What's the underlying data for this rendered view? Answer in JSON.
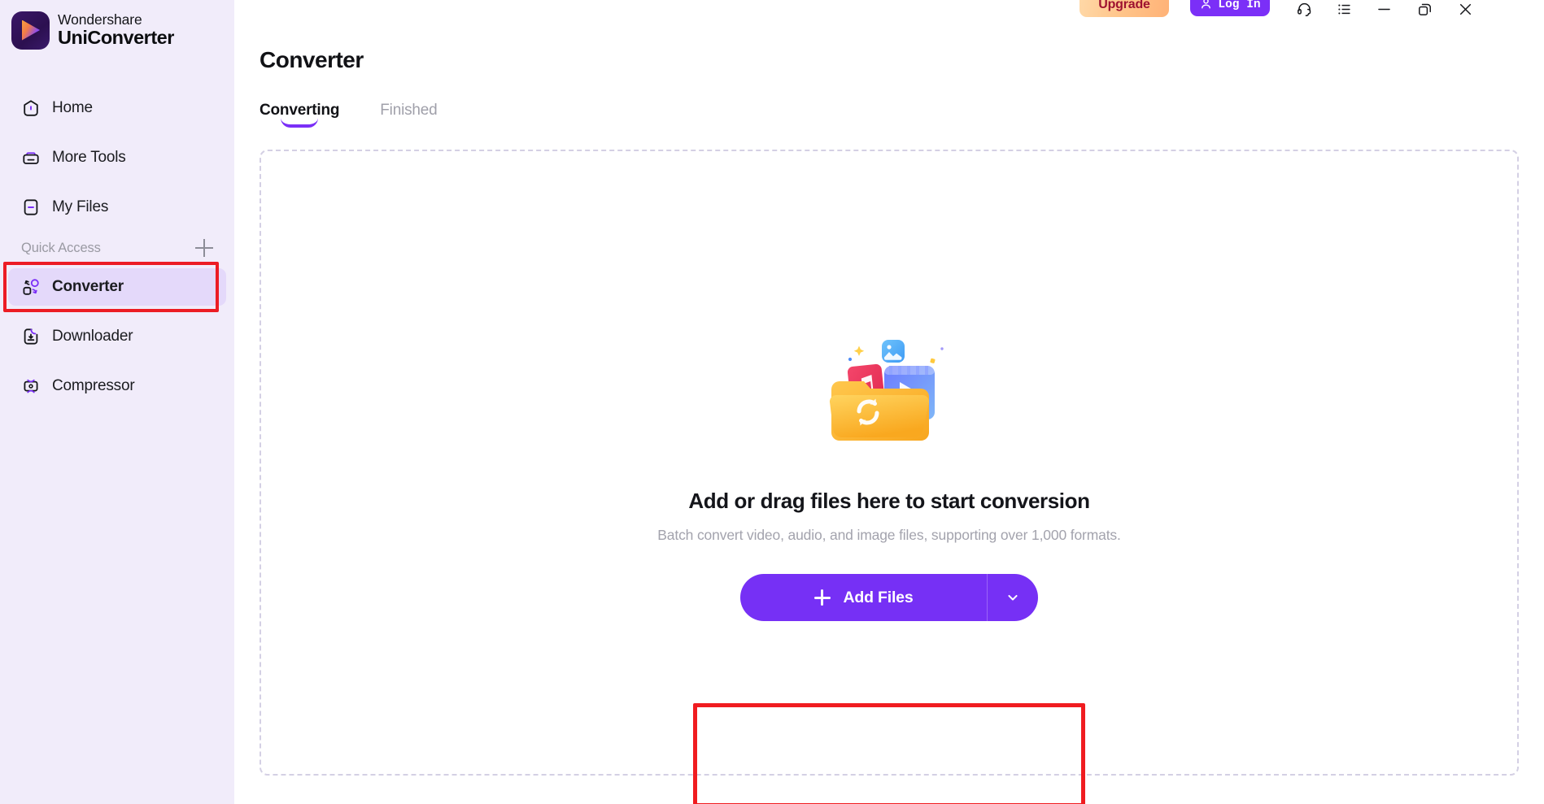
{
  "brand": {
    "line1": "Wondershare",
    "line2": "UniConverter",
    "logo_icon": "play-logo-icon",
    "logo_colors": {
      "bg": "#2c1050",
      "accent_start": "#f9a03c",
      "accent_end": "#b06cf7"
    }
  },
  "sidebar": {
    "background": "#f1ecfa",
    "active_background": "#e4d9fa",
    "items": [
      {
        "id": "home",
        "label": "Home",
        "icon": "home-icon",
        "active": false
      },
      {
        "id": "more-tools",
        "label": "More Tools",
        "icon": "toolbox-icon",
        "active": false
      },
      {
        "id": "my-files",
        "label": "My Files",
        "icon": "file-icon",
        "active": false
      },
      {
        "id": "converter",
        "label": "Converter",
        "icon": "convert-icon",
        "active": true
      },
      {
        "id": "downloader",
        "label": "Downloader",
        "icon": "download-icon",
        "active": false
      },
      {
        "id": "compressor",
        "label": "Compressor",
        "icon": "compress-icon",
        "active": false
      }
    ],
    "quick_access": {
      "label": "Quick Access",
      "add_icon": "plus-icon"
    }
  },
  "header": {
    "upgrade_label": "Upgrade",
    "upgrade_color": "#ffc489",
    "upgrade_text_color": "#9e1230",
    "login_label": "Log In",
    "login_icon": "user-icon",
    "login_color": "#7b2ff7",
    "icons": [
      {
        "id": "support",
        "name": "headset-icon"
      },
      {
        "id": "menu",
        "name": "list-menu-icon"
      },
      {
        "id": "minimize",
        "name": "minimize-icon"
      },
      {
        "id": "maximize",
        "name": "restore-icon"
      },
      {
        "id": "close",
        "name": "close-icon"
      }
    ]
  },
  "main": {
    "page_title": "Converter",
    "tabs": [
      {
        "id": "converting",
        "label": "Converting",
        "active": true
      },
      {
        "id": "finished",
        "label": "Finished",
        "active": false
      }
    ],
    "dropzone": {
      "title": "Add or drag files here to start conversion",
      "subtitle": "Batch convert video, audio, and image files, supporting over 1,000 formats.",
      "illustration": "folder-media-files-illustration",
      "add_files_label": "Add Files",
      "add_files_icon": "plus-icon",
      "add_files_caret_icon": "chevron-down-icon",
      "button_color": "#7630f5"
    }
  },
  "annotations": {
    "highlight_color": "#ec1c24",
    "boxes": [
      {
        "id": "converter-nav",
        "target": "sidebar-item-converter"
      },
      {
        "id": "add-files",
        "target": "add-files-button"
      }
    ]
  }
}
